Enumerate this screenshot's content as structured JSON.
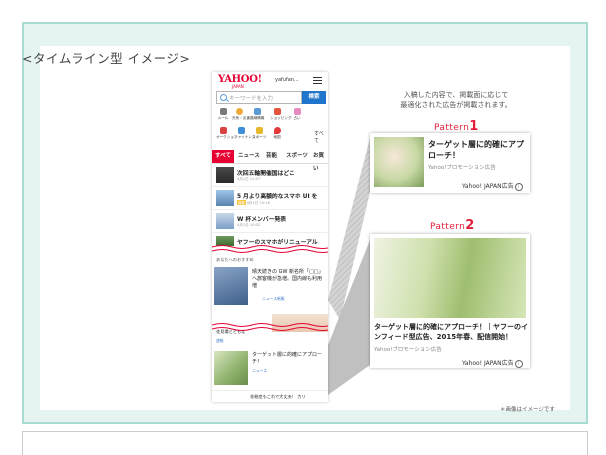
{
  "heading": "<タイムライン型 イメージ>",
  "phone": {
    "logo": "YAHOO!",
    "logo_sub": "JAPAN",
    "user": "yafufan...",
    "search_placeholder": "キーワードを入力",
    "search_button": "検索",
    "services_row1": [
      "メール",
      "天気・災害",
      "路線情報",
      "ショッピング",
      "占い"
    ],
    "services_row2": [
      "オークション",
      "ファイナンス",
      "スポーツ",
      "地図"
    ],
    "services_more": "すべて",
    "tabs": [
      "すべて",
      "ニュース",
      "芸能",
      "スポーツ",
      "お買い"
    ],
    "news": [
      {
        "title": "次回五輪開催国はどこ",
        "meta": "4月1日 11:07",
        "badge": ""
      },
      {
        "title": "5 月より高額的なスマホ UI を",
        "meta": "4月1日 10:16",
        "badge": "速報"
      },
      {
        "title": "W 杯メンバー発表",
        "meta": "4月1日 10:02",
        "badge": ""
      },
      {
        "title": "ヤフーのスマホがリニューアル",
        "meta": "",
        "badge": ""
      }
    ],
    "recommend_label": "あなたへのおすすめ",
    "rec_card": {
      "text": "晴天続きの GW 新名所「□□」へ旅客機が急増。国内線も利用増",
      "meta": "ニュース新報"
    },
    "cut_text": "花見場とともな",
    "cut_meta": "速報",
    "ad_card": {
      "text": "ターゲット層に的確にアプローチ！",
      "meta": "ニュース"
    },
    "bottom_text": "花粉症もこれで大丈夫！ カリ"
  },
  "intro": [
    "入稿した内容で、掲載面に応じて",
    "最適化された広告が掲載されます。"
  ],
  "pattern1": {
    "label": "Pattern",
    "number": "1",
    "title": "ターゲット層に的確にアプローチ！",
    "sub": "Yahoo!プロモーション広告",
    "brand": "Yahoo! JAPAN広告"
  },
  "pattern2": {
    "label": "Pattern",
    "number": "2",
    "title": "ターゲット層に的確にアプローチ！｜ヤフーのインフィード型広告、2015年春、配信開始！",
    "sub": "Yahoo!プロモーション広告",
    "brand": "Yahoo! JAPAN広告"
  },
  "footnote": "＊画像はイメージです",
  "info_icon": "i",
  "colors": {
    "accent": "#e60033",
    "frame": "#a8dcd3",
    "search_button": "#1f75cb",
    "pattern_label": "#e0203b"
  }
}
